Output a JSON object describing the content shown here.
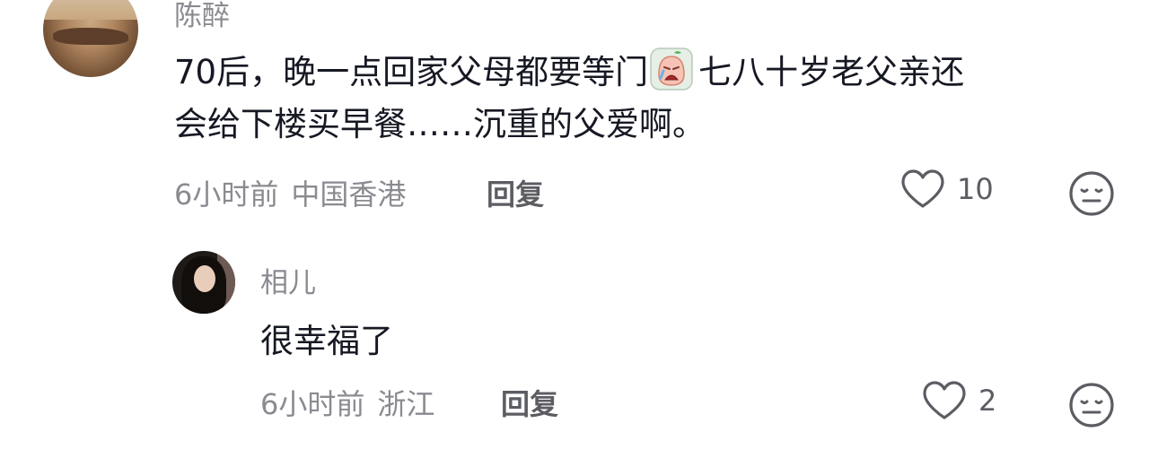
{
  "comments": [
    {
      "username": "陈醉",
      "text_line1": "70后，晚一点回家父母都要等门",
      "emoji": "crying-face-emoji",
      "text_line1_after": "七八十岁老父亲还",
      "text_line2": "会给下楼买早餐……沉重的父爱啊。",
      "time": "6小时前",
      "region": "中国香港",
      "reply_label": "回复",
      "like_count": "10"
    },
    {
      "username": "相儿",
      "text": "很幸福了",
      "time": "6小时前",
      "region": "浙江",
      "reply_label": "回复",
      "like_count": "2"
    }
  ],
  "colors": {
    "text": "#161823",
    "secondary": "#8a8b91",
    "action": "#5c5d63",
    "background": "#ffffff"
  },
  "icons": {
    "like": "heart-outline-icon",
    "dislike": "neutral-face-icon"
  }
}
